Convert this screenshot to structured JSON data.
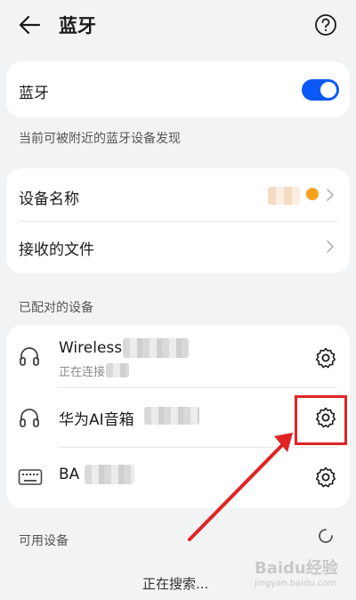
{
  "header": {
    "title": "蓝牙",
    "back_icon": "back-arrow-icon",
    "help_icon": "help-icon"
  },
  "bluetooth": {
    "label": "蓝牙",
    "enabled": true,
    "accent": "#0a59f7"
  },
  "visibility_note": "当前可被附近的蓝牙设备发现",
  "device_name": {
    "label": "设备名称"
  },
  "received_files": {
    "label": "接收的文件"
  },
  "paired": {
    "title": "已配对的设备",
    "devices": [
      {
        "name": "Wireless",
        "status": "正在连接...",
        "icon": "headphones-icon"
      },
      {
        "name": "华为AI音箱",
        "icon": "headphones-icon"
      },
      {
        "name": "BA",
        "icon": "keyboard-icon"
      }
    ]
  },
  "available": {
    "title": "可用设备",
    "searching": "正在搜索..."
  },
  "annotation": {
    "color": "#e02424"
  },
  "watermark": {
    "text": "Baidu经验",
    "sub": "jingyan.baidu.com"
  }
}
